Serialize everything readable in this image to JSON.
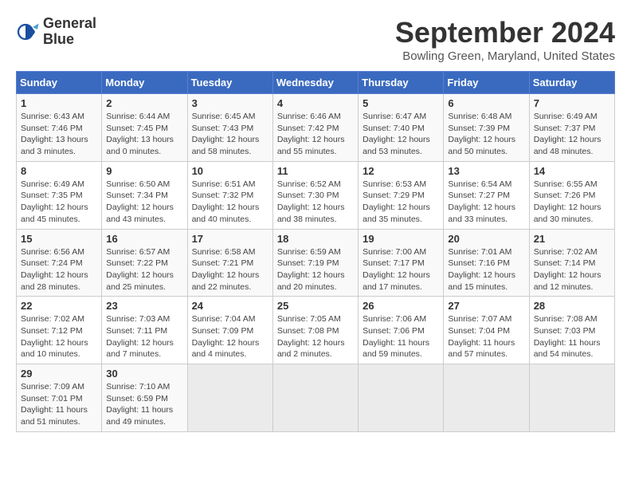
{
  "logo": {
    "line1": "General",
    "line2": "Blue"
  },
  "title": "September 2024",
  "subtitle": "Bowling Green, Maryland, United States",
  "days_of_week": [
    "Sunday",
    "Monday",
    "Tuesday",
    "Wednesday",
    "Thursday",
    "Friday",
    "Saturday"
  ],
  "weeks": [
    [
      {
        "day": "1",
        "sunrise": "6:43 AM",
        "sunset": "7:46 PM",
        "daylight": "13 hours and 3 minutes."
      },
      {
        "day": "2",
        "sunrise": "6:44 AM",
        "sunset": "7:45 PM",
        "daylight": "13 hours and 0 minutes."
      },
      {
        "day": "3",
        "sunrise": "6:45 AM",
        "sunset": "7:43 PM",
        "daylight": "12 hours and 58 minutes."
      },
      {
        "day": "4",
        "sunrise": "6:46 AM",
        "sunset": "7:42 PM",
        "daylight": "12 hours and 55 minutes."
      },
      {
        "day": "5",
        "sunrise": "6:47 AM",
        "sunset": "7:40 PM",
        "daylight": "12 hours and 53 minutes."
      },
      {
        "day": "6",
        "sunrise": "6:48 AM",
        "sunset": "7:39 PM",
        "daylight": "12 hours and 50 minutes."
      },
      {
        "day": "7",
        "sunrise": "6:49 AM",
        "sunset": "7:37 PM",
        "daylight": "12 hours and 48 minutes."
      }
    ],
    [
      {
        "day": "8",
        "sunrise": "6:49 AM",
        "sunset": "7:35 PM",
        "daylight": "12 hours and 45 minutes."
      },
      {
        "day": "9",
        "sunrise": "6:50 AM",
        "sunset": "7:34 PM",
        "daylight": "12 hours and 43 minutes."
      },
      {
        "day": "10",
        "sunrise": "6:51 AM",
        "sunset": "7:32 PM",
        "daylight": "12 hours and 40 minutes."
      },
      {
        "day": "11",
        "sunrise": "6:52 AM",
        "sunset": "7:30 PM",
        "daylight": "12 hours and 38 minutes."
      },
      {
        "day": "12",
        "sunrise": "6:53 AM",
        "sunset": "7:29 PM",
        "daylight": "12 hours and 35 minutes."
      },
      {
        "day": "13",
        "sunrise": "6:54 AM",
        "sunset": "7:27 PM",
        "daylight": "12 hours and 33 minutes."
      },
      {
        "day": "14",
        "sunrise": "6:55 AM",
        "sunset": "7:26 PM",
        "daylight": "12 hours and 30 minutes."
      }
    ],
    [
      {
        "day": "15",
        "sunrise": "6:56 AM",
        "sunset": "7:24 PM",
        "daylight": "12 hours and 28 minutes."
      },
      {
        "day": "16",
        "sunrise": "6:57 AM",
        "sunset": "7:22 PM",
        "daylight": "12 hours and 25 minutes."
      },
      {
        "day": "17",
        "sunrise": "6:58 AM",
        "sunset": "7:21 PM",
        "daylight": "12 hours and 22 minutes."
      },
      {
        "day": "18",
        "sunrise": "6:59 AM",
        "sunset": "7:19 PM",
        "daylight": "12 hours and 20 minutes."
      },
      {
        "day": "19",
        "sunrise": "7:00 AM",
        "sunset": "7:17 PM",
        "daylight": "12 hours and 17 minutes."
      },
      {
        "day": "20",
        "sunrise": "7:01 AM",
        "sunset": "7:16 PM",
        "daylight": "12 hours and 15 minutes."
      },
      {
        "day": "21",
        "sunrise": "7:02 AM",
        "sunset": "7:14 PM",
        "daylight": "12 hours and 12 minutes."
      }
    ],
    [
      {
        "day": "22",
        "sunrise": "7:02 AM",
        "sunset": "7:12 PM",
        "daylight": "12 hours and 10 minutes."
      },
      {
        "day": "23",
        "sunrise": "7:03 AM",
        "sunset": "7:11 PM",
        "daylight": "12 hours and 7 minutes."
      },
      {
        "day": "24",
        "sunrise": "7:04 AM",
        "sunset": "7:09 PM",
        "daylight": "12 hours and 4 minutes."
      },
      {
        "day": "25",
        "sunrise": "7:05 AM",
        "sunset": "7:08 PM",
        "daylight": "12 hours and 2 minutes."
      },
      {
        "day": "26",
        "sunrise": "7:06 AM",
        "sunset": "7:06 PM",
        "daylight": "11 hours and 59 minutes."
      },
      {
        "day": "27",
        "sunrise": "7:07 AM",
        "sunset": "7:04 PM",
        "daylight": "11 hours and 57 minutes."
      },
      {
        "day": "28",
        "sunrise": "7:08 AM",
        "sunset": "7:03 PM",
        "daylight": "11 hours and 54 minutes."
      }
    ],
    [
      {
        "day": "29",
        "sunrise": "7:09 AM",
        "sunset": "7:01 PM",
        "daylight": "11 hours and 51 minutes."
      },
      {
        "day": "30",
        "sunrise": "7:10 AM",
        "sunset": "6:59 PM",
        "daylight": "11 hours and 49 minutes."
      },
      null,
      null,
      null,
      null,
      null
    ]
  ]
}
